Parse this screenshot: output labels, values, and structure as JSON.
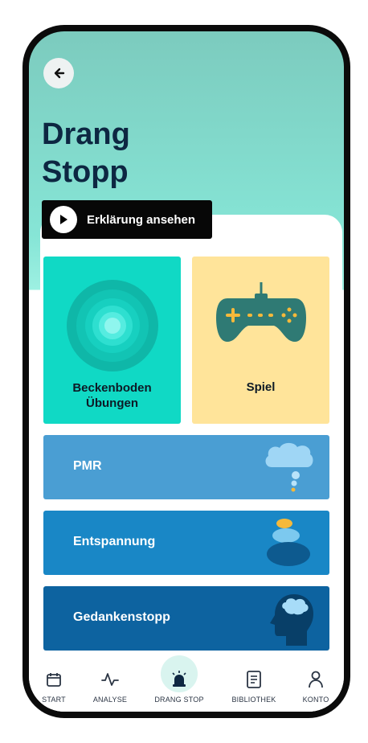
{
  "header": {
    "title_line1": "Drang",
    "title_line2": "Stopp",
    "back_icon": "arrow-left-icon"
  },
  "explain": {
    "label": "Erklärung ansehen",
    "icon": "play-icon"
  },
  "tiles": [
    {
      "label": "Beckenboden\nÜbungen",
      "color": "#10d9c5",
      "icon": "concentric-circles-icon"
    },
    {
      "label": "Spiel",
      "color": "#ffe49a",
      "icon": "gamepad-icon"
    }
  ],
  "rows": [
    {
      "label": "PMR",
      "color": "#4a9ed3",
      "icon": "thought-cloud-icon"
    },
    {
      "label": "Entspannung",
      "color": "#1987c6",
      "icon": "stacked-stones-icon"
    },
    {
      "label": "Gedankenstopp",
      "color": "#0d63a0",
      "icon": "head-brain-icon"
    }
  ],
  "nav": {
    "items": [
      {
        "label": "START",
        "icon": "calendar-icon"
      },
      {
        "label": "ANALYSE",
        "icon": "pulse-icon"
      },
      {
        "label": "DRANG STOP",
        "icon": "siren-icon"
      },
      {
        "label": "BIBLIOTHEK",
        "icon": "document-icon"
      },
      {
        "label": "KONTO",
        "icon": "user-icon"
      }
    ]
  },
  "colors": {
    "title": "#0d2742",
    "header_top": "#7ccbbe",
    "header_bottom": "#9df0e2"
  }
}
